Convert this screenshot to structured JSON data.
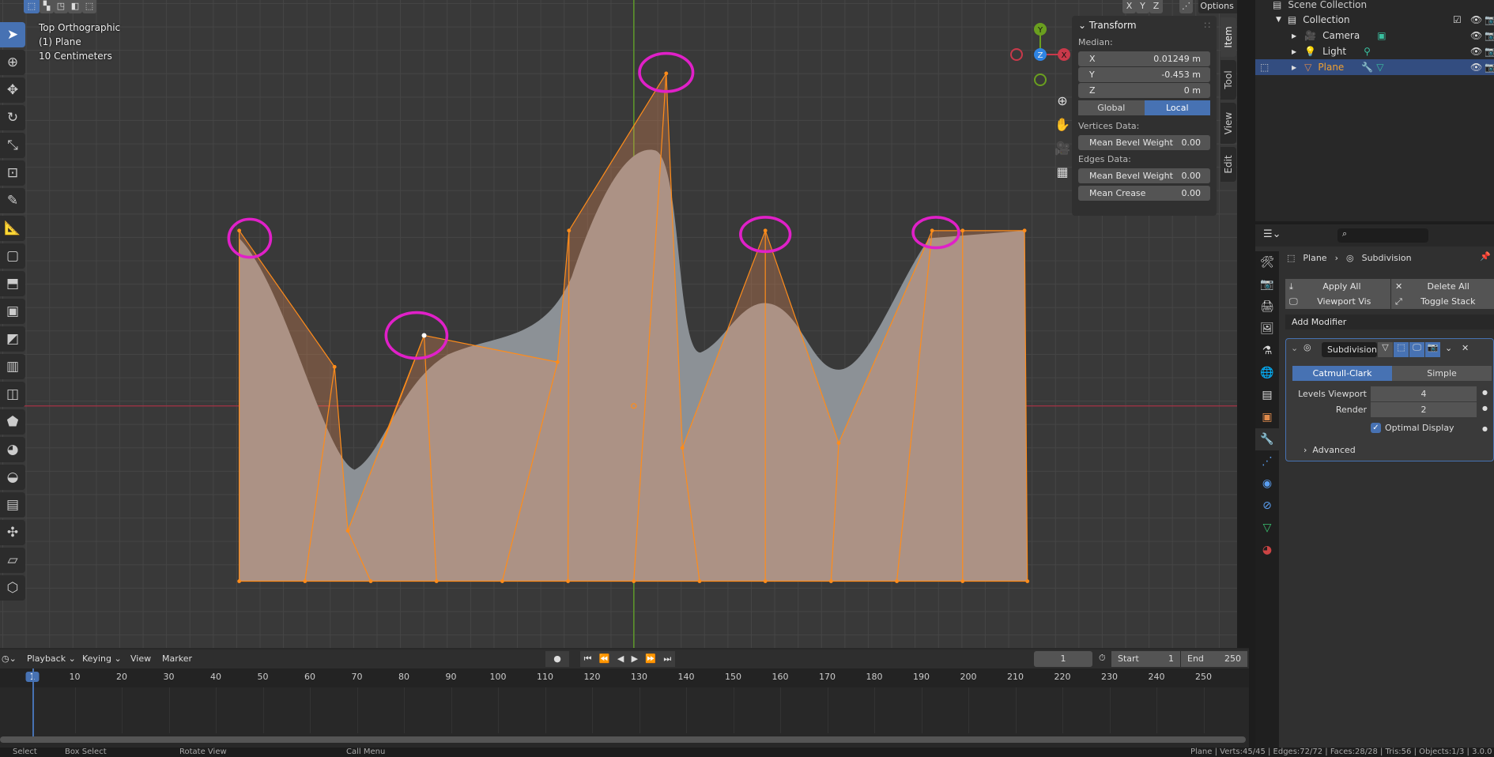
{
  "viewport": {
    "overlay": [
      "Top Orthographic",
      "(1) Plane",
      "10 Centimeters"
    ],
    "header": {
      "axes": [
        "X",
        "Y",
        "Z"
      ],
      "options_label": "Options"
    },
    "gizmo": {
      "x": "X",
      "y": "Y",
      "z": "Z"
    },
    "colors": {
      "selection": "#ff8c1a",
      "annotation": "#e020c8",
      "x_axis": "#c9394a",
      "y_axis": "#6a9f1f",
      "z_axis": "#2f84e3"
    }
  },
  "npanel": {
    "title": "Transform",
    "median_label": "Median:",
    "fields": [
      {
        "label": "X",
        "value": "0.01249 m"
      },
      {
        "label": "Y",
        "value": "-0.453 m"
      },
      {
        "label": "Z",
        "value": "0 m"
      }
    ],
    "space": {
      "global": "Global",
      "local": "Local",
      "active": "Local"
    },
    "vertices_label": "Vertices Data:",
    "vertex_bevel": {
      "label": "Mean Bevel Weight",
      "value": "0.00"
    },
    "edges_label": "Edges Data:",
    "edge_bevel": {
      "label": "Mean Bevel Weight",
      "value": "0.00"
    },
    "edge_crease": {
      "label": "Mean Crease",
      "value": "0.00"
    },
    "tabs": [
      "Item",
      "Tool",
      "View",
      "Edit"
    ],
    "active_tab": "Item"
  },
  "outliner": {
    "root": "Scene Collection",
    "collection": "Collection",
    "items": [
      {
        "name": "Camera"
      },
      {
        "name": "Light"
      },
      {
        "name": "Plane",
        "selected": true
      }
    ]
  },
  "properties": {
    "breadcrumb": [
      "Plane",
      "Subdivision"
    ],
    "apply_all": "Apply All",
    "delete_all": "Delete All",
    "viewport_vis": "Viewport Vis",
    "toggle_stack": "Toggle Stack",
    "add_modifier": "Add Modifier",
    "modifier": {
      "name": "Subdivision",
      "types": [
        "Catmull-Clark",
        "Simple"
      ],
      "active_type": "Catmull-Clark",
      "levels_viewport_label": "Levels Viewport",
      "levels_viewport": "4",
      "render_label": "Render",
      "render": "2",
      "optimal_display_label": "Optimal Display",
      "optimal_display": true,
      "advanced_label": "Advanced"
    }
  },
  "timeline": {
    "menus": [
      "Playback",
      "Keying",
      "View",
      "Marker"
    ],
    "current_frame": "1",
    "start_label": "Start",
    "start": "1",
    "end_label": "End",
    "end": "250",
    "ticks": [
      "1",
      "10",
      "20",
      "30",
      "40",
      "50",
      "60",
      "70",
      "80",
      "90",
      "100",
      "110",
      "120",
      "130",
      "140",
      "150",
      "160",
      "170",
      "180",
      "190",
      "200",
      "210",
      "220",
      "230",
      "240",
      "250"
    ]
  },
  "status": {
    "hints": [
      "Select",
      "Box Select",
      "Rotate View",
      "Call Menu"
    ],
    "stats": "Plane | Verts:45/45 | Edges:72/72 | Faces:28/28 | Tris:56 | Objects:1/3 | 3.0.0"
  }
}
